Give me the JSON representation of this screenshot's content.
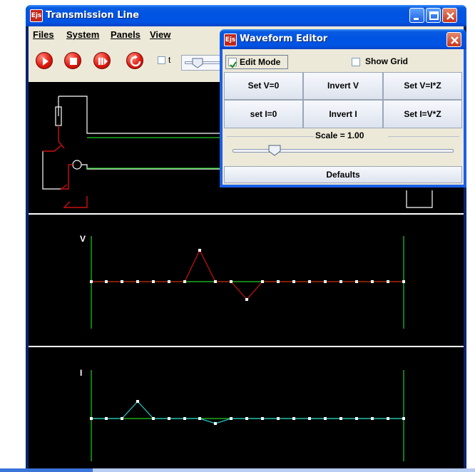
{
  "main_window": {
    "title": "Transmission Line",
    "icon_text": "Ejs",
    "menu": [
      "Files",
      "System",
      "Panels",
      "View"
    ],
    "toolbar": {
      "buttons": [
        "play-button",
        "stop-button",
        "step-button",
        "reset-button"
      ],
      "checkbox_label": "t",
      "checkbox_checked": false
    }
  },
  "editor": {
    "title": "Waveform Editor",
    "icon_text": "Ejs",
    "edit_mode_label": "Edit Mode",
    "edit_mode_checked": true,
    "show_grid_label": "Show Grid",
    "show_grid_checked": false,
    "buttons_row1": [
      "Set V=0",
      "Invert V",
      "Set V=I*Z"
    ],
    "buttons_row2": [
      "set I=0",
      "Invert I",
      "Set I=V*Z"
    ],
    "scale_label": "Scale = 1.00",
    "scale_value": 1.0,
    "defaults_label": "Defaults"
  },
  "plots": {
    "voltage_label": "V",
    "current_label": "I"
  },
  "colors": {
    "wire": "#22cc22",
    "voltage_trace": "#cc1010",
    "current_trace": "#22cccc",
    "plot_bg": "#000000",
    "titlebar": "#0054e3",
    "close_button": "#c8341c"
  }
}
